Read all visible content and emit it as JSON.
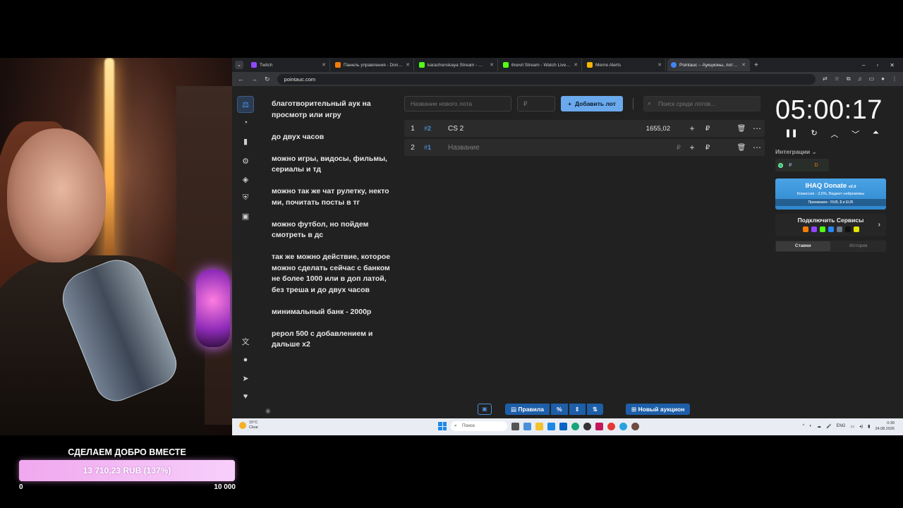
{
  "browser": {
    "tabs": [
      {
        "title": "Twitch",
        "color": "#9146ff",
        "active": false
      },
      {
        "title": "Панель управления - DonationAlerts",
        "color": "#f57d07",
        "active": false
      },
      {
        "title": "karachenskaya Stream - Watch Live",
        "color": "#53fc18",
        "active": false
      },
      {
        "title": "6nevil Stream - Watch Live on Kick",
        "color": "#53fc18",
        "active": false
      },
      {
        "title": "Meme Alerts",
        "color": "#f7b500",
        "active": false
      },
      {
        "title": "Pointauc – Аукционы, лотереи",
        "color": "#4285f4",
        "active": true
      }
    ],
    "url": "pointauc.com"
  },
  "description": [
    "благотворительный аук на просмотр или игру",
    "до  двух часов",
    "можно игры, видосы, фильмы, сериалы и тд",
    "можно так же чат рулетку, некто ми, почитать посты в тг",
    "можно футбол, но пойдем смотреть в дс",
    "так же можно действие, которое можно сделать сейчас с банком не более 1000 или в доп латой, без треша  и до двух часов",
    "минимальный банк - 2000р",
    "рерол 500 с добавлением и дальше x2"
  ],
  "toolbar": {
    "lot_placeholder": "Название нового лота",
    "price_placeholder": "₽",
    "add_label": "Добавить лот",
    "search_placeholder": "Поиск среди лотов..."
  },
  "lots": [
    {
      "num": "1",
      "id": "2",
      "name": "CS 2",
      "amount": "1655,02",
      "currency": "",
      "placeholder": false
    },
    {
      "num": "2",
      "id": "1",
      "name": "Название",
      "amount": "",
      "currency": "₽",
      "placeholder": true
    }
  ],
  "bottom": {
    "rules_label": "Правила",
    "percent_label": "%",
    "new_auction_label": "Новый аукцион"
  },
  "timer": {
    "value": "05:00:17"
  },
  "integrations": {
    "label": "Интеграции",
    "donate_title": "IHAQ Donate",
    "donate_version": "v2.0",
    "donate_sub": "Комиссия - 3,5%, Виджет нейромемы",
    "donate_foot": "Принимаем - RUB, $ и EUR",
    "connect_label": "Подключить Сервисы"
  },
  "history_tabs": {
    "bets": "Ставки",
    "history": "История"
  },
  "taskbar": {
    "weather_temp": "15°C",
    "weather_desc": "Clear",
    "search": "Поиск",
    "lang": "ENG",
    "time": "0:39",
    "date": "24.08.2026"
  },
  "goal": {
    "title": "СДЕЛАЕМ ДОБРО ВМЕСТЕ",
    "progress_text": "13 710,23 RUB (137%)",
    "progress_fraction": 1.0,
    "min": "0",
    "max": "10 000"
  }
}
